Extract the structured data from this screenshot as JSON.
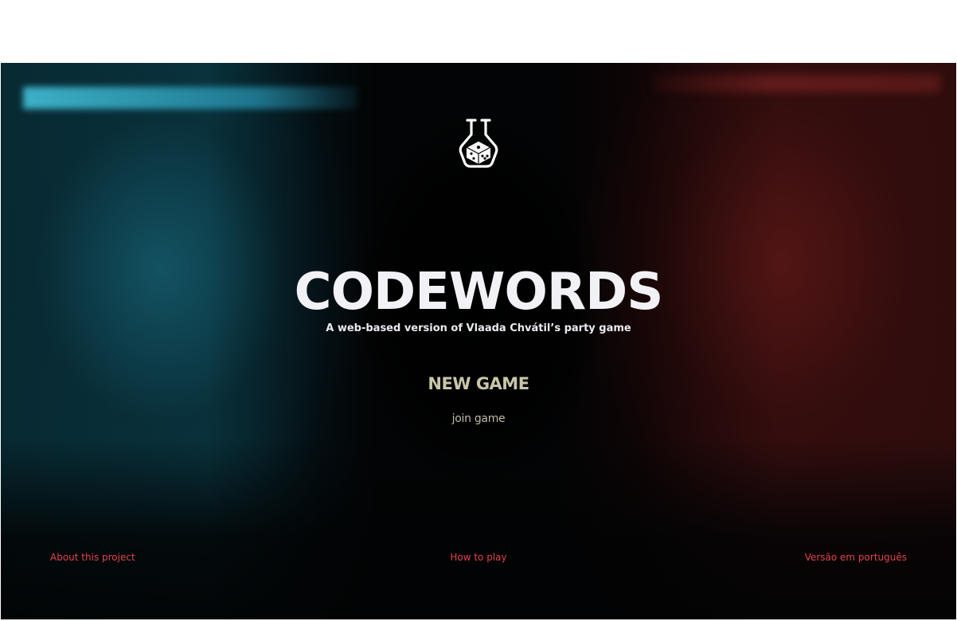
{
  "hero": {
    "logo_icon": "flask-dice-icon",
    "title": "CODEWORDS",
    "subtitle": "A web-based version of Vlaada Chvátil’s party game"
  },
  "actions": {
    "new_game_label": "NEW GAME",
    "join_game_label": "join game"
  },
  "footer": {
    "about_label": "About this project",
    "how_to_play_label": "How to play",
    "portuguese_label": "Versão em português"
  },
  "colors": {
    "title": "#f2f1f6",
    "new_game": "#c9c6a9",
    "footer_link": "#e2424d",
    "background": "#030405",
    "accent_cyan": "#1b6e82",
    "accent_red": "#781e1c"
  }
}
